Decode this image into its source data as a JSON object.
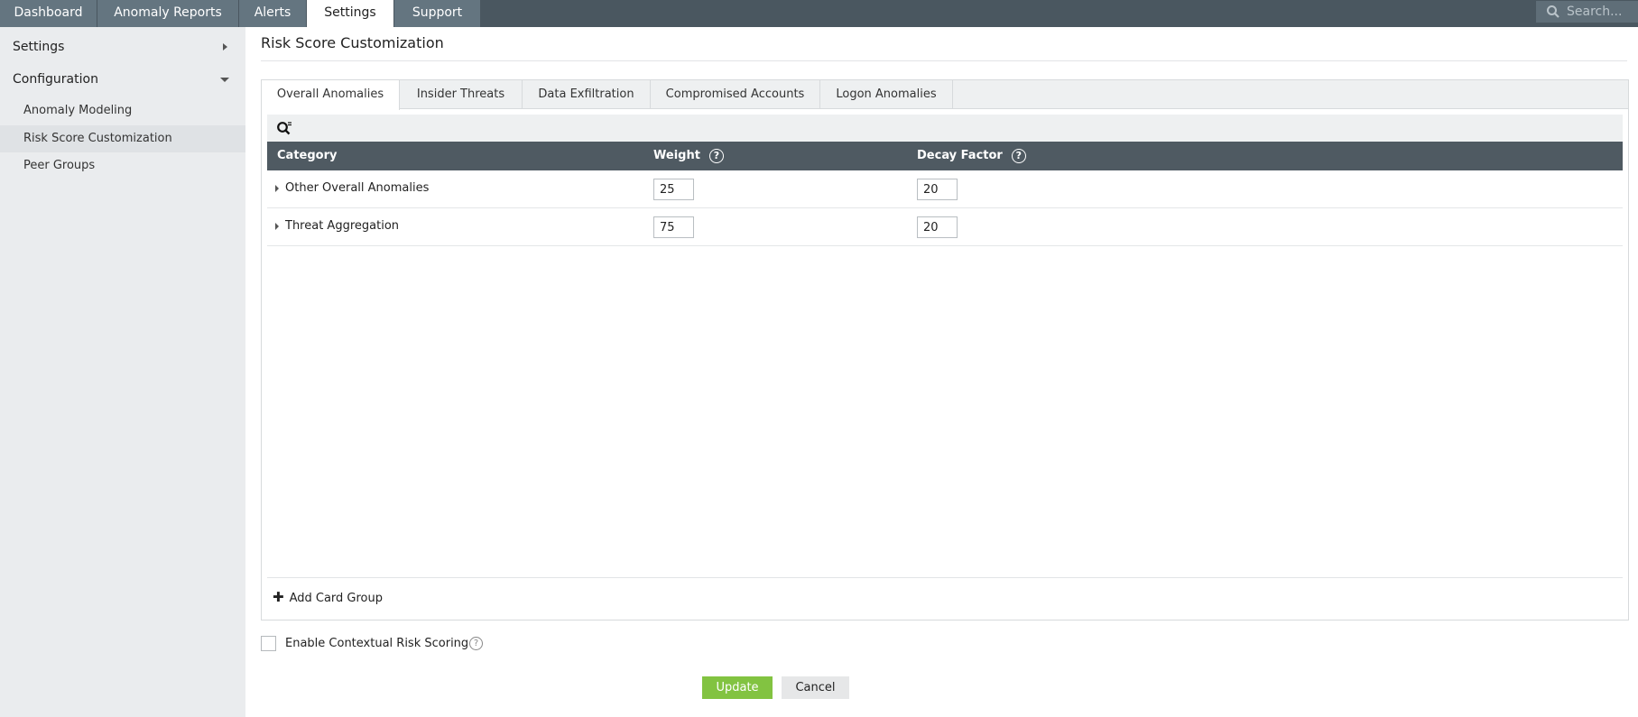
{
  "topnav": {
    "tabs": [
      {
        "label": "Dashboard"
      },
      {
        "label": "Anomaly Reports"
      },
      {
        "label": "Alerts"
      },
      {
        "label": "Settings"
      },
      {
        "label": "Support"
      }
    ],
    "active_tab": "Settings",
    "search_placeholder": "Search..."
  },
  "sidebar": {
    "sections": [
      {
        "label": "Settings",
        "expanded": false
      },
      {
        "label": "Configuration",
        "expanded": true
      }
    ],
    "items": [
      {
        "label": "Anomaly Modeling"
      },
      {
        "label": "Risk Score Customization"
      },
      {
        "label": "Peer Groups"
      }
    ],
    "active_item": "Risk Score Customization"
  },
  "page": {
    "title": "Risk Score Customization"
  },
  "panel": {
    "tabs": [
      {
        "label": "Overall Anomalies"
      },
      {
        "label": "Insider Threats"
      },
      {
        "label": "Data Exfiltration"
      },
      {
        "label": "Compromised Accounts"
      },
      {
        "label": "Logon Anomalies"
      }
    ],
    "active_tab": "Overall Anomalies",
    "table": {
      "headers": {
        "category": "Category",
        "weight": "Weight",
        "decay": "Decay Factor"
      },
      "help_glyph": "?",
      "rows": [
        {
          "category": "Other Overall Anomalies",
          "weight": "25",
          "decay": "20"
        },
        {
          "category": "Threat Aggregation",
          "weight": "75",
          "decay": "20"
        }
      ]
    },
    "add_card_group_label": "Add Card Group"
  },
  "contextual": {
    "label": "Enable Contextual Risk Scoring",
    "checked": false,
    "help_glyph": "?"
  },
  "actions": {
    "update_label": "Update",
    "cancel_label": "Cancel"
  },
  "colors": {
    "topbar": "#4a5760",
    "tab_inactive": "#647580",
    "table_header": "#4f5a62",
    "update_button": "#82c341",
    "sidebar": "#eaecee"
  }
}
